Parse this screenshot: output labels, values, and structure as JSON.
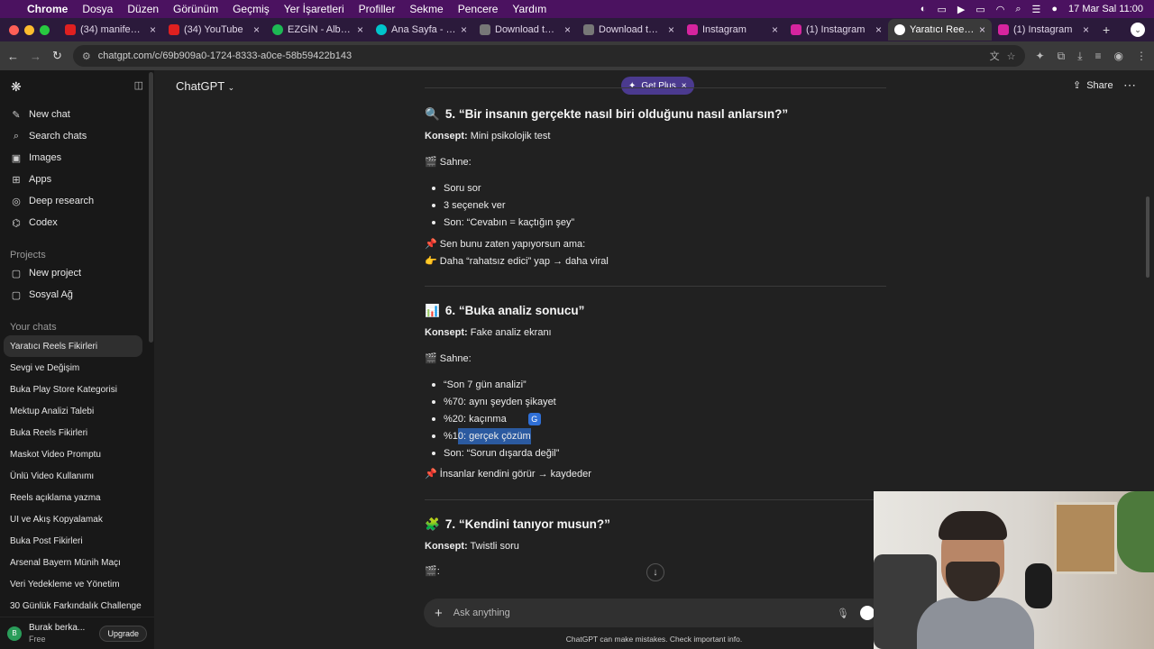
{
  "menubar": {
    "app": "Chrome",
    "items": [
      "Dosya",
      "Düzen",
      "Görünüm",
      "Geçmiş",
      "Yer İşaretleri",
      "Profiller",
      "Sekme",
      "Pencere",
      "Yardım"
    ],
    "datetime": "17 Mar Sal  11:00"
  },
  "tabs": [
    {
      "title": "(34) manifest - R",
      "color": "#e02020"
    },
    {
      "title": "(34) YouTube",
      "color": "#e02020"
    },
    {
      "title": "EZGİN - Album by",
      "color": "#1db954"
    },
    {
      "title": "Ana Sayfa - Canv",
      "color": "#00c4cc"
    },
    {
      "title": "Download this aw",
      "color": "#777777"
    },
    {
      "title": "Download this aw",
      "color": "#777777"
    },
    {
      "title": "Instagram",
      "color": "#d6249f"
    },
    {
      "title": "(1) Instagram",
      "color": "#d6249f"
    },
    {
      "title": "Yaratıcı Reels Fik",
      "color": "#ffffff"
    },
    {
      "title": "(1) Instagram",
      "color": "#d6249f"
    }
  ],
  "address": {
    "url": "chatgpt.com/c/69b909a0-1724-8333-a0ce-58b59422b143"
  },
  "sidebar": {
    "primary": [
      {
        "label": "New chat",
        "icon": "pencil-icon",
        "glyph": "✎"
      },
      {
        "label": "Search chats",
        "icon": "search-icon",
        "glyph": "⌕"
      },
      {
        "label": "Images",
        "icon": "image-icon",
        "glyph": "▣"
      },
      {
        "label": "Apps",
        "icon": "apps-icon",
        "glyph": "⊞"
      },
      {
        "label": "Deep research",
        "icon": "telescope-icon",
        "glyph": "◎"
      },
      {
        "label": "Codex",
        "icon": "code-icon",
        "glyph": "⌬"
      }
    ],
    "projects_label": "Projects",
    "projects": [
      {
        "label": "New project",
        "icon": "folder-plus-icon",
        "glyph": "▢"
      },
      {
        "label": "Sosyal Ağ",
        "icon": "folder-icon",
        "glyph": "▢"
      }
    ],
    "chats_label": "Your chats",
    "chats": [
      "Yaratıcı Reels Fikirleri",
      "Sevgi ve Değişim",
      "Buka Play Store Kategorisi",
      "Mektup Analizi Talebi",
      "Buka Reels Fikirleri",
      "Maskot Video Promptu",
      "Ünlü Video Kullanımı",
      "Reels açıklama yazma",
      "UI ve Akış Kopyalamak",
      "Buka Post Fikirleri",
      "Arsenal Bayern Münih Maçı",
      "Veri Yedekleme ve Yönetim",
      "30 Günlük Farkındalık Challenge"
    ],
    "user": {
      "initial": "B",
      "name": "Burak berka...",
      "plan": "Free",
      "upgrade": "Upgrade"
    }
  },
  "header": {
    "model": "ChatGPT",
    "get_plus": "Get Plus",
    "share": "Share"
  },
  "content": {
    "s5_title": "5. “Bir insanın gerçekte nasıl biri olduğunu nasıl anlarsın?”",
    "s5_konsept_label": "Konsept:",
    "s5_konsept": "Mini psikolojik test",
    "s5_sahne": "Sahne:",
    "s5_bullets": [
      "Soru sor",
      "3 seçenek ver",
      "Son: “Cevabın = kaçtığın şey”"
    ],
    "s5_note1": "Sen bunu zaten yapıyorsun ama:",
    "s5_note2": "Daha “rahatsız edici” yap → daha viral",
    "s6_title": "6. “Buka analiz sonucu”",
    "s6_konsept_label": "Konsept:",
    "s6_konsept": "Fake analiz ekranı",
    "s6_sahne": "Sahne:",
    "s6_b1": "“Son 7 gün analizi”",
    "s6_b2": "%70: aynı şeyden şikayet",
    "s6_b3": "%20: kaçınma",
    "s6_b4a": "%1",
    "s6_b4b": "0: gerçek çözüm",
    "s6_b5": "Son: “Sorun dışarda değil”",
    "s6_note": "İnsanlar kendini görür → kaydeder",
    "s7_title": "7. “Kendini tanıyor musun?”",
    "s7_konsept_label": "Konsept:",
    "s7_konsept": "Twistli soru",
    "s7_partial": ":"
  },
  "composer": {
    "placeholder": "Ask anything"
  },
  "footer": {
    "disclaimer": "ChatGPT can make mistakes. Check important info."
  }
}
